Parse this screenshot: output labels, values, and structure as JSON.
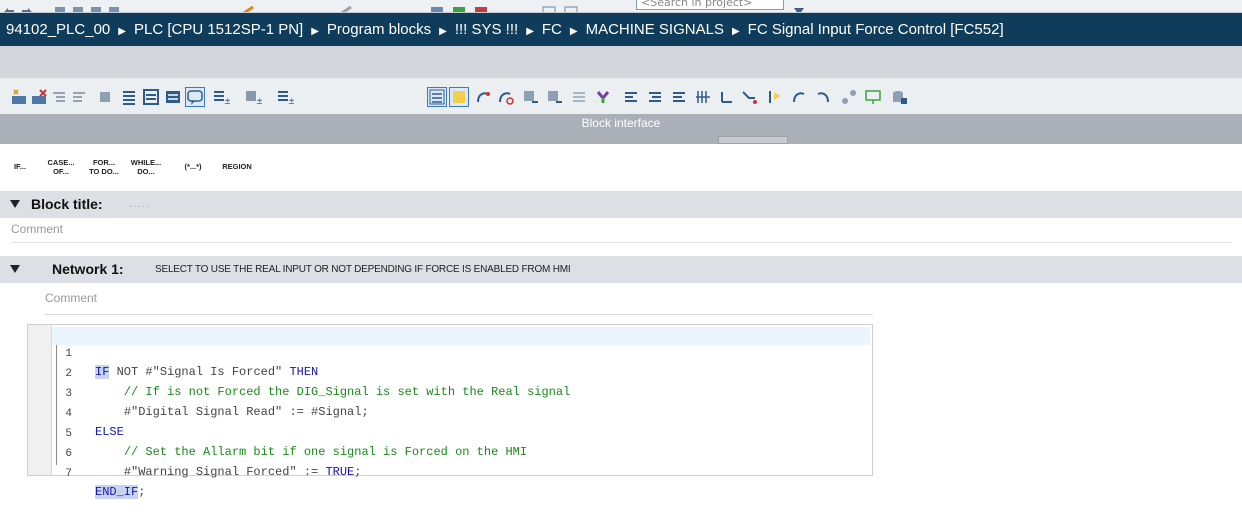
{
  "top_strip": {
    "search_placeholder": "<Search in project>"
  },
  "breadcrumb": {
    "items": [
      "94102_PLC_00",
      "PLC [CPU 1512SP-1 PN]",
      "Program blocks",
      "!!! SYS !!!",
      "FC",
      "MACHINE SIGNALS",
      "FC Signal Input Force Control [FC552]"
    ],
    "separator": "▶"
  },
  "toolbar": {
    "icons": [
      "insert-network-icon",
      "delete-network-icon",
      "indent-icon",
      "outdent-icon",
      "comment-icon",
      "list-icon",
      "list-alt-icon",
      "list-dark-icon",
      "speech-bubble-icon",
      "expand-all-icon",
      "collapse-icon",
      "expand-icon",
      "wrap-icon",
      "favorites-icon",
      "connect-icon",
      "disconnect-icon",
      "monitor-icon",
      "monitor-alt-icon",
      "align-icon",
      "snapshot-icon",
      "step-in-icon",
      "step-over-icon",
      "step-out-icon",
      "breakpoint-icon",
      "line-icon",
      "jump-icon",
      "reset-icon",
      "goto-icon",
      "return-icon",
      "share-icon",
      "display-icon",
      "database-icon"
    ],
    "colors": {
      "accent": "#3a7ac4"
    }
  },
  "block_interface": {
    "label": "Block interface"
  },
  "keywords": [
    {
      "l1": "IF...",
      "l2": ""
    },
    {
      "l1": "CASE...",
      "l2": "OF..."
    },
    {
      "l1": "FOR...",
      "l2": "TO DO..."
    },
    {
      "l1": "WHILE...",
      "l2": "DO..."
    },
    {
      "l1": "(*...*)",
      "l2": ""
    },
    {
      "l1": "REGION",
      "l2": ""
    }
  ],
  "block": {
    "title_label": "Block title:",
    "title_placeholder": ".....",
    "comment_placeholder": "Comment"
  },
  "network": {
    "label": "Network 1:",
    "description": "SELECT TO USE THE REAL INPUT OR NOT DEPENDING IF FORCE IS ENABLED FROM HMI",
    "comment_placeholder": "Comment"
  },
  "code": {
    "line_numbers": [
      "1",
      "2",
      "3",
      "4",
      "5",
      "6",
      "7"
    ],
    "l1": {
      "kw1": "IF",
      "kw2": " NOT ",
      "var": "#\"Signal Is Forced\"",
      "kw3": " THEN"
    },
    "l2": {
      "indent": "    ",
      "comment": "// If is not Forced the DIG_Signal is set with the Real signal"
    },
    "l3": {
      "indent": "    ",
      "text": "#\"Digital Signal Read\" := #Signal;"
    },
    "l4": {
      "kw": "ELSE"
    },
    "l5": {
      "indent": "    ",
      "comment": "// Set the Allarm bit if one signal is Forced on the HMI"
    },
    "l6": {
      "indent": "    ",
      "var": "#\"Warning Signal Forced\" := ",
      "kw": "TRUE",
      "end": ";"
    },
    "l7": {
      "kw": "END_IF",
      "end": ";"
    },
    "colors": {
      "keyword": "#1515b5",
      "comment": "#1a8a1a",
      "highlight": "#c8d3ef"
    }
  }
}
